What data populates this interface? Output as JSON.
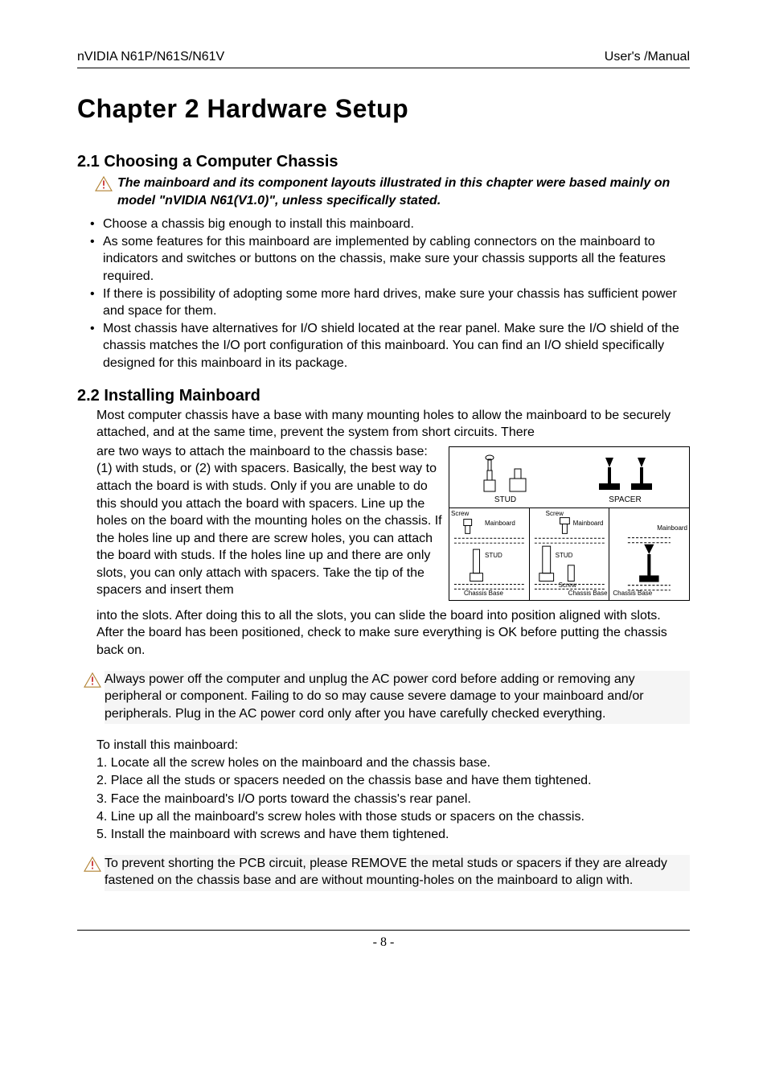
{
  "header": {
    "left": "nVIDIA N61P/N61S/N61V",
    "right": "User's /Manual"
  },
  "chapter_title": "Chapter 2 Hardware Setup",
  "section21": {
    "heading": "2.1 Choosing a Computer Chassis",
    "note": "The mainboard and its component layouts illustrated in this chapter were based mainly on model \"nVIDIA N61(V1.0)\", unless specifically stated.",
    "bullets": [
      "Choose a chassis big enough to install this mainboard.",
      "As some features for this mainboard are implemented by cabling connectors on the mainboard to indicators and switches or buttons on the chassis, make sure your chassis supports all the features required.",
      "If there is possibility of adopting some more hard drives, make sure your chassis has sufficient power and space for them.",
      "Most chassis have alternatives for I/O shield located at the rear panel. Make sure the I/O shield of the chassis matches the I/O port configuration of this mainboard. You can find an I/O shield specifically designed for this mainboard in its package."
    ]
  },
  "section22": {
    "heading": "2.2 Installing Mainboard",
    "para1_pre_float": "Most computer chassis have a base with many mounting holes to allow the mainboard to be securely attached, and at the same time, prevent the system from short circuits. There",
    "para1_with_float": "are two ways to attach the mainboard to the chassis base: (1) with studs, or (2) with spacers. Basically, the best way to attach the board is with studs. Only if you are unable to do this should you attach the board with spacers. Line up the holes on the board with the mounting holes on the chassis. If the holes line up and there are screw holes, you can attach the board with studs. If the holes line up and there are only slots, you can only attach with spacers. Take the tip of the spacers and insert them",
    "para1_post_float": "into the slots. After doing this to all the slots, you can slide the board into position aligned with slots. After the board has been positioned, check to make sure everything is OK before putting the chassis back on.",
    "notice1": "Always power off the computer and unplug the AC power cord before adding or removing any peripheral or component. Failing to do so may cause severe damage to your mainboard and/or peripherals. Plug in the AC power cord only after you have carefully checked everything.",
    "install_lead": "To install this mainboard:",
    "steps": [
      "1. Locate all the screw holes on the mainboard and the chassis base.",
      "2. Place all the studs or spacers needed on the chassis base and have them tightened.",
      "3. Face the mainboard's I/O ports toward the chassis's rear panel.",
      "4. Line up all the mainboard's screw holes with those studs or spacers on the chassis.",
      "5. Install the mainboard with screws and have them tightened."
    ],
    "notice2": "To prevent shorting the PCB circuit, please REMOVE the metal studs or spacers if they are already fastened on the chassis base and are without mounting-holes on the mainboard to align with."
  },
  "figure": {
    "stud_label": "STUD",
    "spacer_label": "SPACER",
    "screw_label": "Screw",
    "mainboard_label": "Mainboard",
    "chassis_label": "Chassis Base"
  },
  "page_number": "- 8 -"
}
